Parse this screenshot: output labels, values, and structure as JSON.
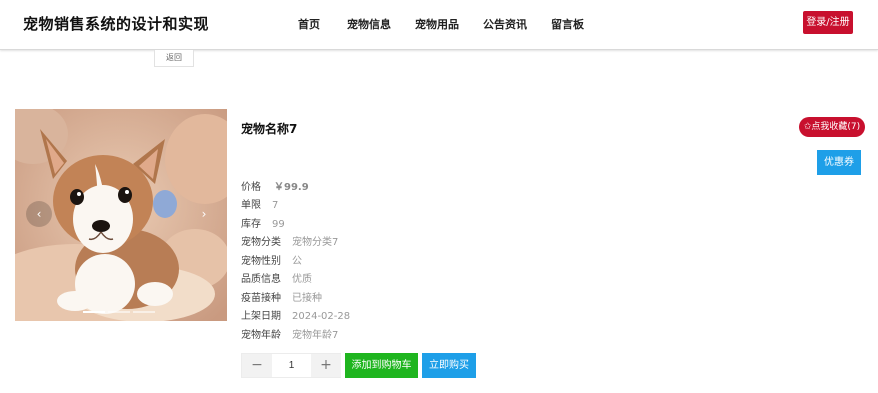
{
  "header": {
    "site_title": "宠物销售系统的设计和实现",
    "nav": [
      "首页",
      "宠物信息",
      "宠物用品",
      "公告资讯",
      "留言板"
    ],
    "login_label": "登录/注册"
  },
  "back_label": "返回",
  "product": {
    "name": "宠物名称7",
    "favorite_label": "✩点我收藏(7)",
    "coupon_label": "优惠券",
    "attributes": [
      {
        "key": "价格",
        "value": "￥99.9"
      },
      {
        "key": "单限",
        "value": "7"
      },
      {
        "key": "库存",
        "value": "99"
      },
      {
        "key": "宠物分类",
        "value": "宠物分类7"
      },
      {
        "key": "宠物性别",
        "value": "公"
      },
      {
        "key": "品质信息",
        "value": "优质"
      },
      {
        "key": "疫苗接种",
        "value": "已接种"
      },
      {
        "key": "上架日期",
        "value": "2024-02-28"
      },
      {
        "key": "宠物年龄",
        "value": "宠物年龄7"
      }
    ],
    "quantity": "1",
    "minus_label": "−",
    "plus_label": "+",
    "add_to_cart_label": "添加到购物车",
    "buy_now_label": "立即购买"
  },
  "carousel": {
    "prev_icon": "‹",
    "next_icon": "›",
    "image_subject": "corgi-puppy-photo",
    "slide_count": 3,
    "active_slide": 1
  },
  "colors": {
    "brand_red": "#c8102e",
    "accent_blue": "#1e9fe8",
    "cart_green": "#1fb51f"
  }
}
